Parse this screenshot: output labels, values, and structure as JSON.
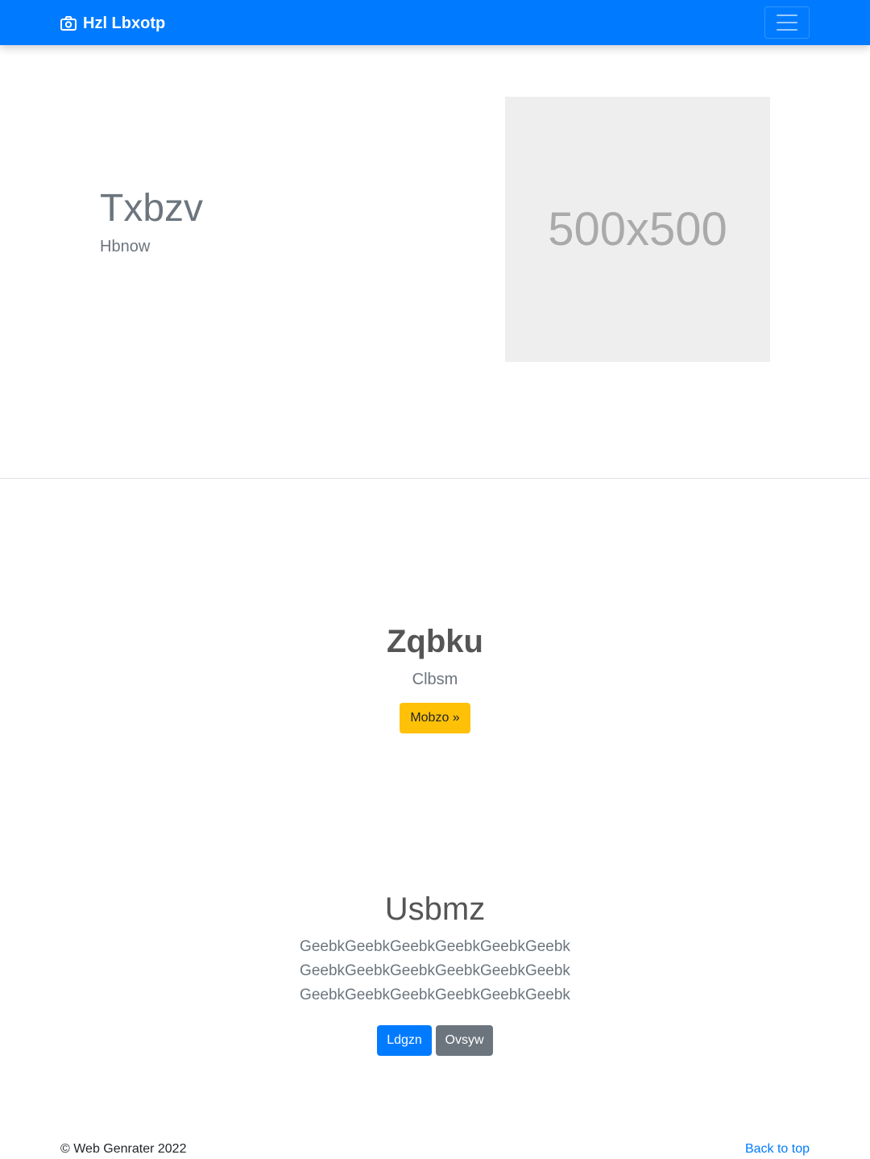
{
  "navbar": {
    "brand_icon": "camera-icon",
    "brand_text": "Hzl Lbxotp",
    "toggler_icon": "hamburger-menu-icon",
    "bg_color": "#007bff"
  },
  "hero": {
    "title": "Txbzv",
    "subtitle": "Hbnow",
    "image_placeholder": "500x500"
  },
  "cta": {
    "title": "Zqbku",
    "subtitle": "Clbsm",
    "button_label": "Mobzo »",
    "button_color": "#ffc107"
  },
  "feature": {
    "title": "Usbmz",
    "lines": [
      "GeebkGeebkGeebkGeebkGeebkGeebk",
      "GeebkGeebkGeebkGeebkGeebkGeebk",
      "GeebkGeebkGeebkGeebkGeebkGeebk"
    ],
    "primary_label": "Ldgzn",
    "secondary_label": "Ovsyw"
  },
  "footer": {
    "copyright": "© Web Genrater 2022",
    "back_to_top": "Back to top"
  }
}
